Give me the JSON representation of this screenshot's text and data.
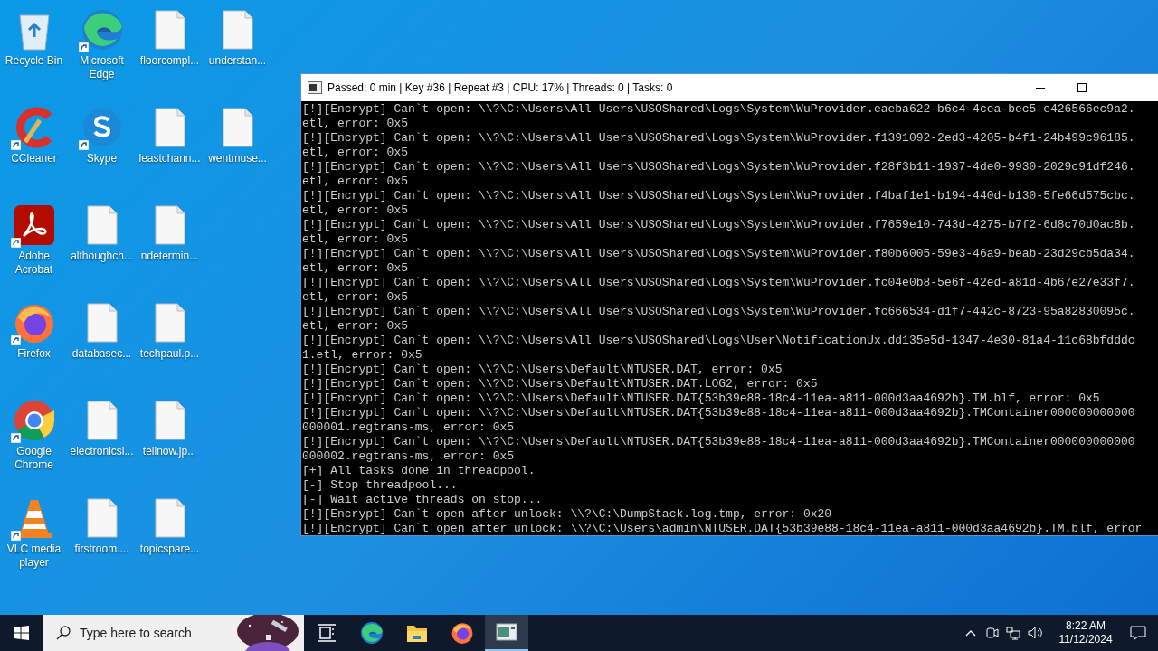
{
  "desktop": {
    "icons": [
      {
        "kind": "recycle",
        "label": "Recycle Bin",
        "shortcut": false
      },
      {
        "kind": "ccleaner",
        "label": "CCleaner",
        "shortcut": true
      },
      {
        "kind": "acrobat",
        "label": "Adobe Acrobat",
        "shortcut": true
      },
      {
        "kind": "firefox",
        "label": "Firefox",
        "shortcut": true
      },
      {
        "kind": "chrome",
        "label": "Google Chrome",
        "shortcut": true
      },
      {
        "kind": "vlc",
        "label": "VLC media player",
        "shortcut": true
      },
      {
        "kind": "edge",
        "label": "Microsoft Edge",
        "shortcut": true
      },
      {
        "kind": "skype",
        "label": "Skype",
        "shortcut": true
      },
      {
        "kind": "file",
        "label": "althoughch...",
        "shortcut": false
      },
      {
        "kind": "file",
        "label": "databasec...",
        "shortcut": false
      },
      {
        "kind": "file",
        "label": "electronicsl...",
        "shortcut": false
      },
      {
        "kind": "file",
        "label": "firstroom....",
        "shortcut": false
      },
      {
        "kind": "file",
        "label": "floorcompl...",
        "shortcut": false
      },
      {
        "kind": "file",
        "label": "leastchann...",
        "shortcut": false
      },
      {
        "kind": "file",
        "label": "ndetermin...",
        "shortcut": false
      },
      {
        "kind": "file",
        "label": "techpaul.p...",
        "shortcut": false
      },
      {
        "kind": "file",
        "label": "tellnow.jp...",
        "shortcut": false
      },
      {
        "kind": "file",
        "label": "topicspare...",
        "shortcut": false
      },
      {
        "kind": "file",
        "label": "understan...",
        "shortcut": false
      },
      {
        "kind": "file",
        "label": "wentmuse...",
        "shortcut": false
      }
    ]
  },
  "console_window": {
    "title": "Passed: 0 min | Key #36 | Repeat #3 | CPU: 17% | Threads: 0 | Tasks: 0",
    "lines": [
      "[!][Encrypt] Can`t open: \\\\?\\C:\\Users\\All Users\\USOShared\\Logs\\System\\WuProvider.eaeba622-b6c4-4cea-bec5-e426566ec9a2.",
      "etl, error: 0x5",
      "[!][Encrypt] Can`t open: \\\\?\\C:\\Users\\All Users\\USOShared\\Logs\\System\\WuProvider.f1391092-2ed3-4205-b4f1-24b499c96185.",
      "etl, error: 0x5",
      "[!][Encrypt] Can`t open: \\\\?\\C:\\Users\\All Users\\USOShared\\Logs\\System\\WuProvider.f28f3b11-1937-4de0-9930-2029c91df246.",
      "etl, error: 0x5",
      "[!][Encrypt] Can`t open: \\\\?\\C:\\Users\\All Users\\USOShared\\Logs\\System\\WuProvider.f4baf1e1-b194-440d-b130-5fe66d575cbc.",
      "etl, error: 0x5",
      "[!][Encrypt] Can`t open: \\\\?\\C:\\Users\\All Users\\USOShared\\Logs\\System\\WuProvider.f7659e10-743d-4275-b7f2-6d8c70d0ac8b.",
      "etl, error: 0x5",
      "[!][Encrypt] Can`t open: \\\\?\\C:\\Users\\All Users\\USOShared\\Logs\\System\\WuProvider.f80b6005-59e3-46a9-beab-23d29cb5da34.",
      "etl, error: 0x5",
      "[!][Encrypt] Can`t open: \\\\?\\C:\\Users\\All Users\\USOShared\\Logs\\System\\WuProvider.fc04e0b8-5e6f-42ed-a81d-4b67e27e33f7.",
      "etl, error: 0x5",
      "[!][Encrypt] Can`t open: \\\\?\\C:\\Users\\All Users\\USOShared\\Logs\\System\\WuProvider.fc666534-d1f7-442c-8723-95a82830095c.",
      "etl, error: 0x5",
      "[!][Encrypt] Can`t open: \\\\?\\C:\\Users\\All Users\\USOShared\\Logs\\User\\NotificationUx.dd135e5d-1347-4e30-81a4-11c68bfdddc",
      "1.etl, error: 0x5",
      "[!][Encrypt] Can`t open: \\\\?\\C:\\Users\\Default\\NTUSER.DAT, error: 0x5",
      "[!][Encrypt] Can`t open: \\\\?\\C:\\Users\\Default\\NTUSER.DAT.LOG2, error: 0x5",
      "[!][Encrypt] Can`t open: \\\\?\\C:\\Users\\Default\\NTUSER.DAT{53b39e88-18c4-11ea-a811-000d3aa4692b}.TM.blf, error: 0x5",
      "[!][Encrypt] Can`t open: \\\\?\\C:\\Users\\Default\\NTUSER.DAT{53b39e88-18c4-11ea-a811-000d3aa4692b}.TMContainer000000000000",
      "000001.regtrans-ms, error: 0x5",
      "[!][Encrypt] Can`t open: \\\\?\\C:\\Users\\Default\\NTUSER.DAT{53b39e88-18c4-11ea-a811-000d3aa4692b}.TMContainer000000000000",
      "000002.regtrans-ms, error: 0x5",
      "[+] All tasks done in threadpool.",
      "[-] Stop threadpool...",
      "[-] Wait active threads on stop...",
      "[!][Encrypt] Can`t open after unlock: \\\\?\\C:\\DumpStack.log.tmp, error: 0x20",
      "[!][Encrypt] Can`t open after unlock: \\\\?\\C:\\Users\\admin\\NTUSER.DAT{53b39e88-18c4-11ea-a811-000d3aa4692b}.TM.blf, error"
    ]
  },
  "taskbar": {
    "search": {
      "placeholder": "Type here to search",
      "kind": "picture"
    },
    "apps": [
      {
        "kind": "taskview",
        "selected": false
      },
      {
        "kind": "edge",
        "selected": false
      },
      {
        "kind": "explorer",
        "selected": false
      },
      {
        "kind": "firefox",
        "selected": false
      },
      {
        "kind": "console",
        "selected": true
      }
    ],
    "clock": {
      "time": "8:22 AM",
      "date": "11/12/2024"
    }
  }
}
